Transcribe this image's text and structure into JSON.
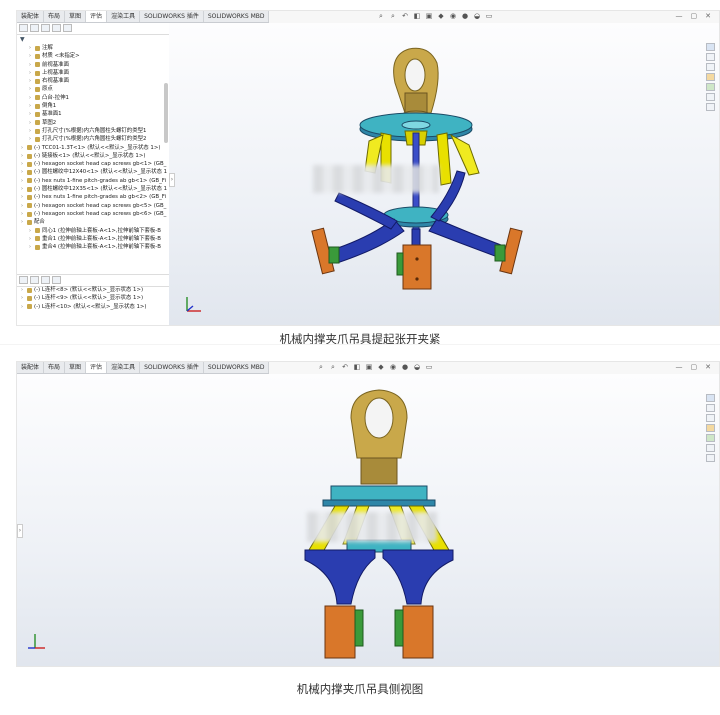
{
  "tabs": [
    "装配体",
    "布局",
    "草图",
    "评估",
    "渲染工具",
    "SOLIDWORKS 插件",
    "SOLIDWORKS MBD"
  ],
  "active_tab": "评估",
  "view_tool_icons": [
    "search-icon",
    "zoom-area-icon",
    "previous-view-icon",
    "section-view-icon",
    "view-orientation-icon",
    "display-style-icon",
    "hide-show-icon",
    "edit-appearance-icon",
    "scene-icon",
    "display-settings-icon"
  ],
  "window_controls": [
    "—",
    "▢",
    "✕"
  ],
  "feature_tree": [
    {
      "label": "注解",
      "icon": "annotation-icon",
      "indent": 1
    },
    {
      "label": "材质 <未指定>",
      "icon": "material-icon",
      "indent": 1
    },
    {
      "label": "前视基准面",
      "icon": "plane-icon",
      "indent": 1
    },
    {
      "label": "上视基准面",
      "icon": "plane-icon",
      "indent": 1
    },
    {
      "label": "右视基准面",
      "icon": "plane-icon",
      "indent": 1
    },
    {
      "label": "原点",
      "icon": "origin-icon",
      "indent": 1
    },
    {
      "label": "凸台-拉伸1",
      "icon": "extrude-icon",
      "indent": 1
    },
    {
      "label": "倒角1",
      "icon": "chamfer-icon",
      "indent": 1
    },
    {
      "label": "基准面1",
      "icon": "plane-icon",
      "indent": 1
    },
    {
      "label": "草图2",
      "icon": "sketch-icon",
      "indent": 1
    },
    {
      "label": "打孔尺寸(%根据)内六角圆柱头螺钉的类型1",
      "icon": "hole-icon",
      "indent": 1
    },
    {
      "label": "打孔尺寸(%根据)内六角圆柱头螺钉的类型2",
      "icon": "hole-icon",
      "indent": 1
    },
    {
      "label": "(-) TCC01-1.3T<1> (默认<<默认>_显示状态 1>)",
      "icon": "part-icon",
      "indent": 0
    },
    {
      "label": "(-) 链接板<1> (默认<<默认>_显示状态 1>)",
      "icon": "part-icon",
      "indent": 0
    },
    {
      "label": "(-) hexagon socket head cap screws gb<1> (GB_",
      "icon": "part-icon",
      "indent": 0
    },
    {
      "label": "(-) 圆柱螺纹中12X40<1> (默认<<默认>_显示状态 1",
      "icon": "part-icon",
      "indent": 0
    },
    {
      "label": "(-) hex nuts 1-fine pitch-grades ab gb<1> (GB_Fi",
      "icon": "part-icon",
      "indent": 0
    },
    {
      "label": "(-) 圆柱螺纹中12X35<1> (默认<<默认>_显示状态 1",
      "icon": "part-icon",
      "indent": 0
    },
    {
      "label": "(-) hex nuts 1-fine pitch-grades ab gb<2> (GB_Fi",
      "icon": "part-icon",
      "indent": 0
    },
    {
      "label": "(-) hexagon socket head cap screws gb<5> (GB_",
      "icon": "part-icon",
      "indent": 0
    },
    {
      "label": "(-) hexagon socket head cap screws gb<6> (GB_",
      "icon": "part-icon",
      "indent": 0
    },
    {
      "label": "配合",
      "icon": "mates-icon",
      "indent": 0
    },
    {
      "label": "同心1 (拉伸前轴上套板-A<1>,拉伸前轴下套板-B",
      "icon": "concentric-icon",
      "indent": 1
    },
    {
      "label": "重合1 (拉伸前轴上套板-A<1>,拉伸前轴下套板-B",
      "icon": "coincident-icon",
      "indent": 1
    },
    {
      "label": "重合4 (拉伸前轴上套板-A<1>,拉伸前轴下套板-B",
      "icon": "coincident-icon",
      "indent": 1
    }
  ],
  "lower_tree": [
    {
      "label": "(-) L连杆<8> (默认<<默认>_显示状态 1>)",
      "icon": "part-icon"
    },
    {
      "label": "(-) L连杆<9> (默认<<默认>_显示状态 1>)",
      "icon": "part-icon"
    },
    {
      "label": "(-) L连杆<10> (默认<<默认>_显示状态 1>)",
      "icon": "part-icon"
    }
  ],
  "captions": {
    "first": "机械内撑夹爪吊具提起张开夹紧",
    "second": "机械内撑夹爪吊具侧视图"
  },
  "colors": {
    "frame_blue": "#2a3db0",
    "plate_teal": "#3fb3c2",
    "link_yellow": "#e8e000",
    "pad_orange": "#d9772a",
    "pad_green": "#3a9a3a",
    "ring_gold": "#c9a84a"
  }
}
